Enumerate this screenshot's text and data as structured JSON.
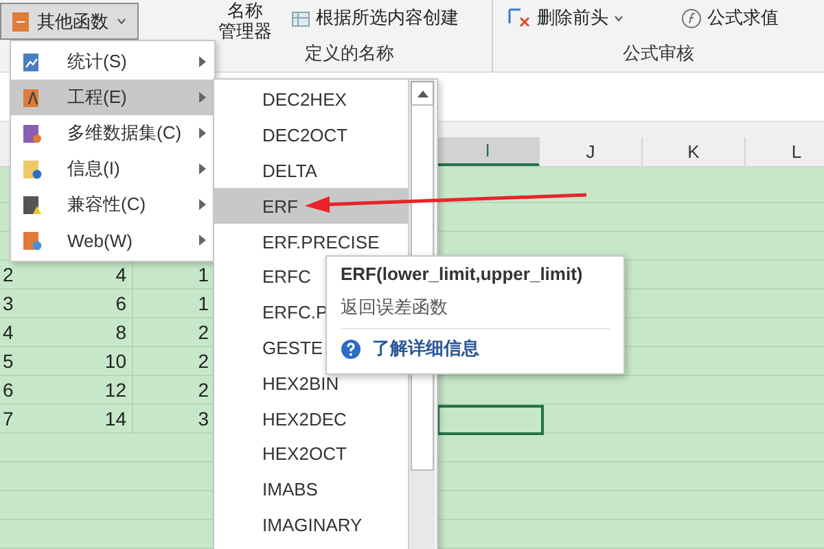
{
  "ribbon": {
    "more_functions_button": {
      "label": "其他函数",
      "expanded": true
    },
    "name_manager": {
      "line_1": "名称",
      "line_2": "管理器"
    },
    "create_from_selection": "根据所选内容创建",
    "defined_names_group": "定义的名称",
    "remove_arrows": "删除前头",
    "evaluate_formula": "公式求值",
    "formula_auditing_group": "公式审核"
  },
  "columns": [
    {
      "label": "I",
      "selected": true
    },
    {
      "label": "J",
      "selected": false
    },
    {
      "label": "K",
      "selected": false
    },
    {
      "label": "L",
      "selected": false
    }
  ],
  "rows": [
    {
      "number": "2",
      "column_2": "4",
      "column_3": "1"
    },
    {
      "number": "3",
      "column_2": "6",
      "column_3": "1"
    },
    {
      "number": "4",
      "column_2": "8",
      "column_3": "2"
    },
    {
      "number": "5",
      "column_2": "10",
      "column_3": "2"
    },
    {
      "number": "6",
      "column_2": "12",
      "column_3": "2"
    },
    {
      "number": "7",
      "column_2": "14",
      "column_3": "3",
      "active_cell": true
    }
  ],
  "category_menu": [
    {
      "label": "统计(S)",
      "kind": "chart",
      "selected": false
    },
    {
      "label": "工程(E)",
      "kind": "compass",
      "selected": true
    },
    {
      "label": "多维数据集(C)",
      "kind": "cube",
      "selected": false
    },
    {
      "label": "信息(I)",
      "kind": "info",
      "selected": false
    },
    {
      "label": "兼容性(C)",
      "kind": "warning",
      "selected": false
    },
    {
      "label": "Web(W)",
      "kind": "globe",
      "selected": false
    }
  ],
  "function_menu": [
    {
      "label": "DEC2HEX",
      "selected": false
    },
    {
      "label": "DEC2OCT",
      "selected": false
    },
    {
      "label": "DELTA",
      "selected": false
    },
    {
      "label": "ERF",
      "selected": true
    },
    {
      "label": "ERF.PRECISE",
      "selected": false
    },
    {
      "label": "ERFC",
      "selected": false
    },
    {
      "label": "ERFC.P",
      "selected": false
    },
    {
      "label": "GESTE",
      "selected": false
    },
    {
      "label": "HEX2BIN",
      "selected": false
    },
    {
      "label": "HEX2DEC",
      "selected": false
    },
    {
      "label": "HEX2OCT",
      "selected": false
    },
    {
      "label": "IMABS",
      "selected": false
    },
    {
      "label": "IMAGINARY",
      "selected": false
    }
  ],
  "tooltip": {
    "signature": "ERF(lower_limit,upper_limit)",
    "description": "返回误差函数",
    "help_link": "了解详细信息"
  }
}
